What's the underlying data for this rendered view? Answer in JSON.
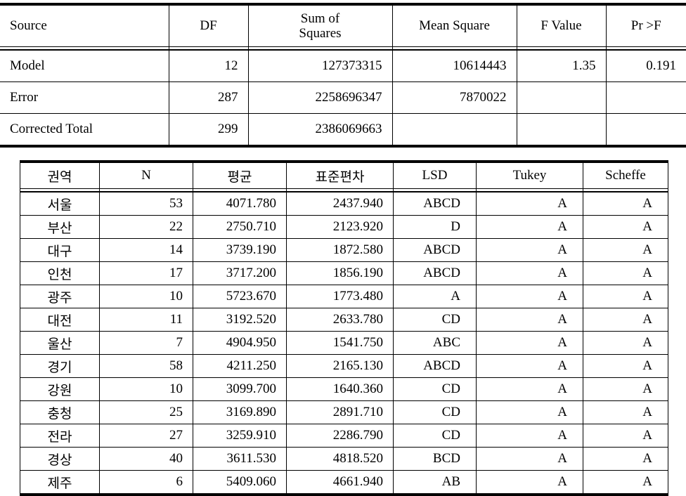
{
  "anova": {
    "headers": [
      {
        "label": "Source",
        "align": "left"
      },
      {
        "label": "DF",
        "align": "center"
      },
      {
        "label_line1": "Sum of",
        "label_line2": "Squares",
        "align": "center"
      },
      {
        "label": "Mean Square",
        "align": "center"
      },
      {
        "label": "F Value",
        "align": "center"
      },
      {
        "label": "Pr >F",
        "align": "center"
      }
    ],
    "header_labels": {
      "source": "Source",
      "df": "DF",
      "sum_of_squares_line1": "Sum of",
      "sum_of_squares_line2": "Squares",
      "mean_square": "Mean Square",
      "f_value": "F Value",
      "pr_f": "Pr >F"
    },
    "rows": [
      {
        "source": "Model",
        "df": "12",
        "sum_of_squares": "127373315",
        "mean_square": "10614443",
        "f_value": "1.35",
        "pr_f": "0.191"
      },
      {
        "source": "Error",
        "df": "287",
        "sum_of_squares": "2258696347",
        "mean_square": "7870022",
        "f_value": "",
        "pr_f": ""
      },
      {
        "source": "Corrected  Total",
        "df": "299",
        "sum_of_squares": "2386069663",
        "mean_square": "",
        "f_value": "",
        "pr_f": ""
      }
    ]
  },
  "posthoc": {
    "header_labels": {
      "region": "권역",
      "n": "N",
      "mean": "평균",
      "std_dev": "표준편차",
      "lsd": "LSD",
      "tukey": "Tukey",
      "scheffe": "Scheffe"
    },
    "rows": [
      {
        "region": "서울",
        "n": "53",
        "mean": "4071.780",
        "std_dev": "2437.940",
        "lsd": "ABCD",
        "tukey": "A",
        "scheffe": "A"
      },
      {
        "region": "부산",
        "n": "22",
        "mean": "2750.710",
        "std_dev": "2123.920",
        "lsd": "D",
        "tukey": "A",
        "scheffe": "A"
      },
      {
        "region": "대구",
        "n": "14",
        "mean": "3739.190",
        "std_dev": "1872.580",
        "lsd": "ABCD",
        "tukey": "A",
        "scheffe": "A"
      },
      {
        "region": "인천",
        "n": "17",
        "mean": "3717.200",
        "std_dev": "1856.190",
        "lsd": "ABCD",
        "tukey": "A",
        "scheffe": "A"
      },
      {
        "region": "광주",
        "n": "10",
        "mean": "5723.670",
        "std_dev": "1773.480",
        "lsd": "A",
        "tukey": "A",
        "scheffe": "A"
      },
      {
        "region": "대전",
        "n": "11",
        "mean": "3192.520",
        "std_dev": "2633.780",
        "lsd": "CD",
        "tukey": "A",
        "scheffe": "A"
      },
      {
        "region": "울산",
        "n": "7",
        "mean": "4904.950",
        "std_dev": "1541.750",
        "lsd": "ABC",
        "tukey": "A",
        "scheffe": "A"
      },
      {
        "region": "경기",
        "n": "58",
        "mean": "4211.250",
        "std_dev": "2165.130",
        "lsd": "ABCD",
        "tukey": "A",
        "scheffe": "A"
      },
      {
        "region": "강원",
        "n": "10",
        "mean": "3099.700",
        "std_dev": "1640.360",
        "lsd": "CD",
        "tukey": "A",
        "scheffe": "A"
      },
      {
        "region": "충청",
        "n": "25",
        "mean": "3169.890",
        "std_dev": "2891.710",
        "lsd": "CD",
        "tukey": "A",
        "scheffe": "A"
      },
      {
        "region": "전라",
        "n": "27",
        "mean": "3259.910",
        "std_dev": "2286.790",
        "lsd": "CD",
        "tukey": "A",
        "scheffe": "A"
      },
      {
        "region": "경상",
        "n": "40",
        "mean": "3611.530",
        "std_dev": "4818.520",
        "lsd": "BCD",
        "tukey": "A",
        "scheffe": "A"
      },
      {
        "region": "제주",
        "n": "6",
        "mean": "5409.060",
        "std_dev": "4661.940",
        "lsd": "AB",
        "tukey": "A",
        "scheffe": "A"
      }
    ]
  },
  "chart_data": {
    "type": "table",
    "title": "ANOVA results and regional multiple-comparison groupings",
    "tables": [
      {
        "name": "anova",
        "columns": [
          "Source",
          "DF",
          "Sum of Squares",
          "Mean Square",
          "F Value",
          "Pr >F"
        ],
        "rows": [
          [
            "Model",
            12,
            127373315,
            10614443,
            1.35,
            0.191
          ],
          [
            "Error",
            287,
            2258696347,
            7870022,
            null,
            null
          ],
          [
            "Corrected Total",
            299,
            2386069663,
            null,
            null,
            null
          ]
        ]
      },
      {
        "name": "regional-means",
        "columns": [
          "권역",
          "N",
          "평균",
          "표준편차",
          "LSD",
          "Tukey",
          "Scheffe"
        ],
        "rows": [
          [
            "서울",
            53,
            4071.78,
            2437.94,
            "ABCD",
            "A",
            "A"
          ],
          [
            "부산",
            22,
            2750.71,
            2123.92,
            "D",
            "A",
            "A"
          ],
          [
            "대구",
            14,
            3739.19,
            1872.58,
            "ABCD",
            "A",
            "A"
          ],
          [
            "인천",
            17,
            3717.2,
            1856.19,
            "ABCD",
            "A",
            "A"
          ],
          [
            "광주",
            10,
            5723.67,
            1773.48,
            "A",
            "A",
            "A"
          ],
          [
            "대전",
            11,
            3192.52,
            2633.78,
            "CD",
            "A",
            "A"
          ],
          [
            "울산",
            7,
            4904.95,
            1541.75,
            "ABC",
            "A",
            "A"
          ],
          [
            "경기",
            58,
            4211.25,
            2165.13,
            "ABCD",
            "A",
            "A"
          ],
          [
            "강원",
            10,
            3099.7,
            1640.36,
            "CD",
            "A",
            "A"
          ],
          [
            "충청",
            25,
            3169.89,
            2891.71,
            "CD",
            "A",
            "A"
          ],
          [
            "전라",
            27,
            3259.91,
            2286.79,
            "CD",
            "A",
            "A"
          ],
          [
            "경상",
            40,
            3611.53,
            4818.52,
            "BCD",
            "A",
            "A"
          ],
          [
            "제주",
            6,
            5409.06,
            4661.94,
            "AB",
            "A",
            "A"
          ]
        ]
      }
    ]
  }
}
